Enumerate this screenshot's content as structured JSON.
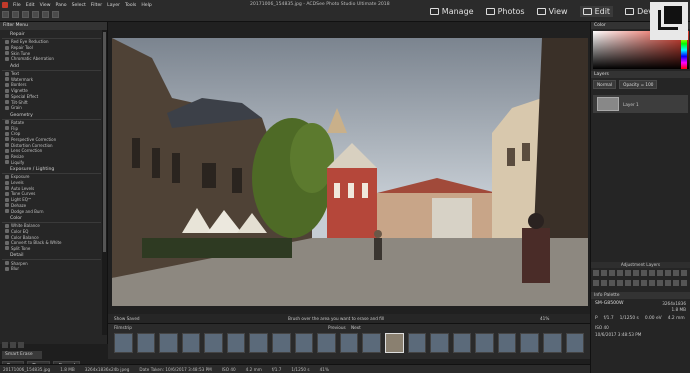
{
  "app": {
    "window_title": "20171006_154835.jpg - ACDSee Photo Studio Ultimate 2018",
    "menus": [
      "File",
      "Edit",
      "View",
      "Pano",
      "Select",
      "Filter",
      "Layer",
      "Tools",
      "Help"
    ],
    "modes": [
      {
        "label": "Manage",
        "icon": "manage-icon"
      },
      {
        "label": "Photos",
        "icon": "photos-icon"
      },
      {
        "label": "View",
        "icon": "view-icon"
      },
      {
        "label": "Edit",
        "icon": "edit-icon"
      },
      {
        "label": "Develop",
        "icon": "develop-icon"
      }
    ]
  },
  "left_panel": {
    "title": "Filter Menu",
    "sections": [
      {
        "title": "Repair",
        "items": [
          "Red Eye Reduction",
          "Repair Tool",
          "Skin Tune",
          "Chromatic Aberration"
        ]
      },
      {
        "title": "Add",
        "items": [
          "Text",
          "Watermark",
          "Borders",
          "Vignette",
          "Special Effect",
          "Tilt-Shift",
          "Grain"
        ]
      },
      {
        "title": "Geometry",
        "items": [
          "Rotate",
          "Flip",
          "Crop",
          "Perspective Correction",
          "Distortion Correction",
          "Lens Correction",
          "Resize",
          "Liquify"
        ]
      },
      {
        "title": "Exposure / Lighting",
        "items": [
          "Exposure",
          "Levels",
          "Auto Levels",
          "Tone Curves",
          "Light EQ™",
          "Dehaze",
          "Dodge and Burn"
        ]
      },
      {
        "title": "Color",
        "items": [
          "White Balance",
          "Color EQ",
          "Color Balance",
          "Convert to Black & White",
          "Split Tone"
        ]
      },
      {
        "title": "Detail",
        "items": [
          "Sharpen",
          "Blur"
        ]
      }
    ],
    "smart_erase": "Smart Erase",
    "buttons": {
      "save": "Save",
      "done": "Done",
      "cancel": "Cancel"
    }
  },
  "image": {
    "show_saved": "Show Saved",
    "hint": "Brush over the area you want to erase and fill",
    "zoom": "41%"
  },
  "filmstrip": {
    "title": "Filmstrip",
    "previous": "Previous",
    "next": "Next",
    "thumbnail_count": 21,
    "selected_index": 12
  },
  "right_panel": {
    "color_title": "Color",
    "layers_title": "Layers",
    "blend_mode": "Normal",
    "opacity": "Opacity = 100",
    "layer_name": "Layer 1",
    "adjustment_layers": "Adjustment Layers",
    "info_title": "Info Palette",
    "camera": "SM-G8500W",
    "info_right": [
      "3264x1836",
      "1.8 MB"
    ],
    "exif": [
      {
        "label": "P",
        "value": "f/1.7"
      },
      {
        "label": "",
        "value": "1/1250 s"
      },
      {
        "label": "",
        "value": "0.00 eV"
      },
      {
        "label": "",
        "value": "4.2 mm"
      }
    ],
    "iso": "ISO 40",
    "timestamp": "10/6/2017 3:48:53 PM"
  },
  "status": {
    "items": [
      "20171006_154835.jpg",
      "1.8 MB",
      "3264x1836x24b jpeg",
      "Date Taken: 10/6/2017 3:48:53 PM",
      "ISO 40",
      "4.2 mm",
      "f/1.7",
      "1/1250 s",
      "41%"
    ]
  }
}
